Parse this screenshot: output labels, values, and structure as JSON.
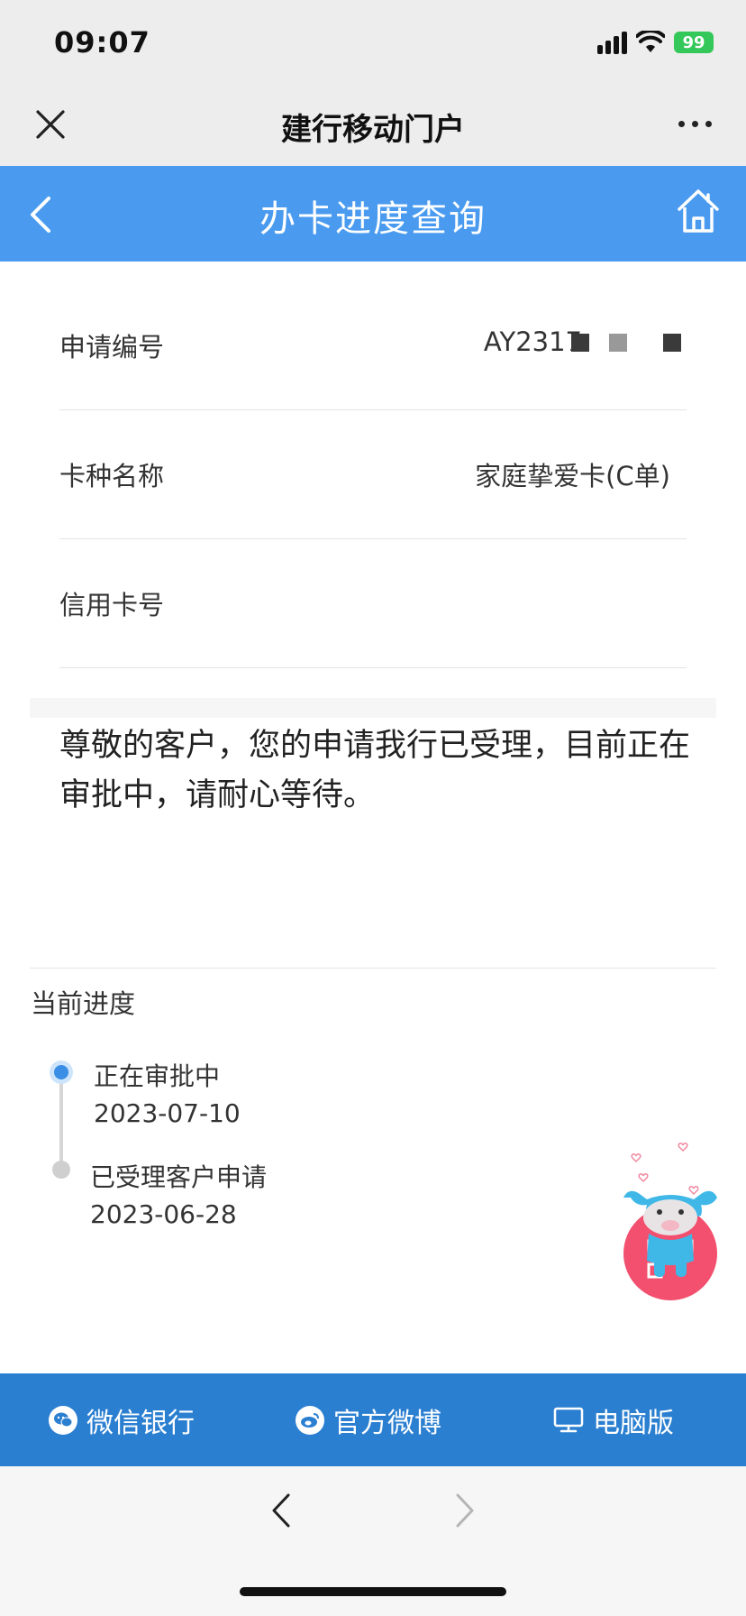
{
  "status_bar": {
    "time": "09:07",
    "battery": "99"
  },
  "wechat_header": {
    "title": "建行移动门户"
  },
  "page_header": {
    "title": "办卡进度查询"
  },
  "info_rows": [
    {
      "label": "申请编号",
      "value": "AY2317"
    },
    {
      "label": "卡种名称",
      "value": "家庭挚爱卡(C单)"
    },
    {
      "label": "信用卡号",
      "value": ""
    }
  ],
  "notice": "尊敬的客户，您的申请我行已受理，目前正在审批中，请耐心等待。",
  "progress": {
    "title": "当前进度",
    "steps": [
      {
        "status": "正在审批中",
        "date": "2023-07-10",
        "active": true
      },
      {
        "status": "已受理客户申请",
        "date": "2023-06-28",
        "active": false
      }
    ]
  },
  "footer": {
    "wechat_bank": "微信银行",
    "weibo": "官方微博",
    "pc_version": "电脑版"
  },
  "colors": {
    "header_blue": "#4a9bef",
    "footer_blue": "#2b7fd1",
    "active_dot": "#3a8ee6"
  }
}
